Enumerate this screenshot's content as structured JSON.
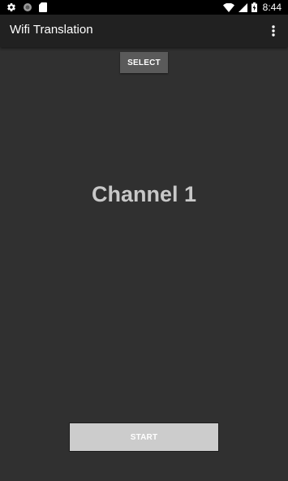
{
  "status_bar": {
    "time": "8:44",
    "left_icons": [
      "settings-gear-icon",
      "circle-status-icon",
      "sd-card-icon"
    ],
    "right_icons": [
      "wifi-icon",
      "cell-signal-icon",
      "battery-charging-icon"
    ]
  },
  "app_bar": {
    "title": "Wifi Translation",
    "overflow_icon": "more-vert-icon"
  },
  "main": {
    "select_label": "SELECT",
    "channel_text": "Channel 1",
    "start_label": "START"
  },
  "colors": {
    "background": "#303030",
    "app_bar": "#212121",
    "status_bar": "#000000",
    "select_button": "#5a5a5a",
    "start_button": "#cccccc",
    "channel_text": "#c8c8c8"
  }
}
